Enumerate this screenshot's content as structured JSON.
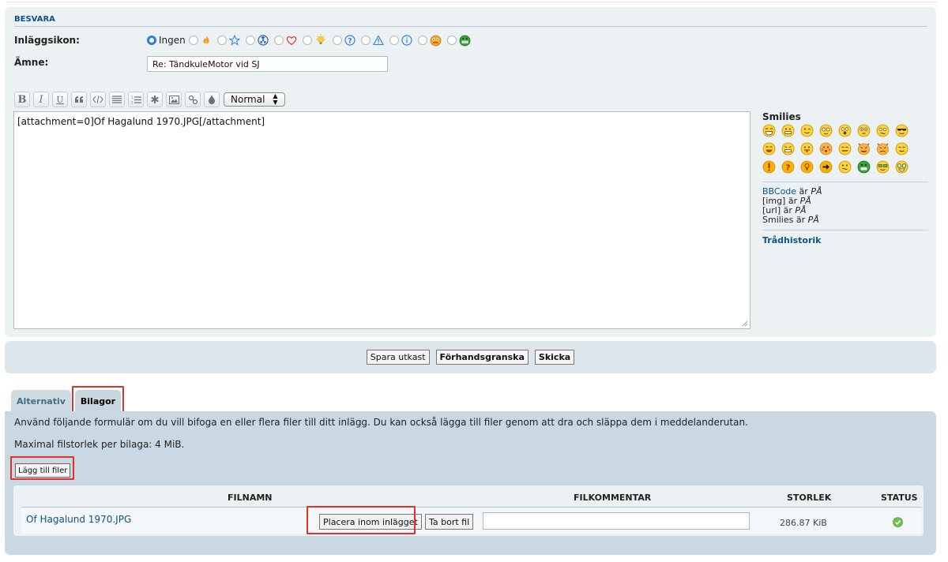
{
  "reply": {
    "section_title": "BESVARA",
    "post_icon_label": "Inläggsikon:",
    "icon_none_label": "Ingen",
    "post_icons": [
      "fire-icon",
      "star-icon",
      "radioactive-icon",
      "heart-icon",
      "lightbulb-icon",
      "question-icon",
      "warning-icon",
      "info-icon",
      "mad-face-icon",
      "grin-face-icon"
    ],
    "subject_label": "Ämne:",
    "subject_value": "Re: TändkuleMotor vid SJ"
  },
  "toolbar": {
    "buttons": [
      "bold-icon",
      "italic-icon",
      "underline-icon",
      "quote-icon",
      "code-icon",
      "list-icon",
      "ordered-list-icon",
      "list-item-icon",
      "image-icon",
      "link-icon",
      "color-icon"
    ],
    "bold": "B",
    "italic": "I",
    "underline": "U",
    "font_size_value": "Normal"
  },
  "editor": {
    "content": "[attachment=0]Of Hagalund 1970.JPG[/attachment]"
  },
  "sidebar": {
    "smilies_title": "Smilies",
    "bbcode_link": "BBCode",
    "bbcode_text": " är ",
    "bbcode_state": "PÅ",
    "img_text": "[img] är ",
    "img_state": "PÅ",
    "url_text": "[url] är ",
    "url_state": "PÅ",
    "smilies_text": "Smilies är ",
    "smilies_state": "PÅ",
    "thread_history": "Trådhistorik"
  },
  "submit": {
    "save_draft": "Spara utkast",
    "preview": "Förhandsgranska",
    "send": "Skicka"
  },
  "tabs": {
    "options": "Alternativ",
    "attachments": "Bilagor"
  },
  "attachments": {
    "instructions": "Använd följande formulär om du vill bifoga en eller flera filer till ditt inlägg. Du kan också lägga till filer genom att dra och släppa dem i meddelanderutan.",
    "max_size": "Maximal filstorlek per bilaga: 4 MiB.",
    "add_files": "Lägg till filer",
    "columns": {
      "filename": "FILNAMN",
      "comment": "FILKOMMENTAR",
      "size": "STORLEK",
      "status": "STATUS"
    },
    "files": [
      {
        "name": "Of Hagalund 1970.JPG",
        "place_inline": "Placera inom inlägget",
        "delete": "Ta bort fil",
        "comment": "",
        "size": "286.87 KiB",
        "status_icon": "check-circle-icon"
      }
    ]
  },
  "colors": {
    "accent": "#105289",
    "panel": "#ecf1f3",
    "attach_panel": "#c9d8e2",
    "highlight": "#e0312b"
  }
}
